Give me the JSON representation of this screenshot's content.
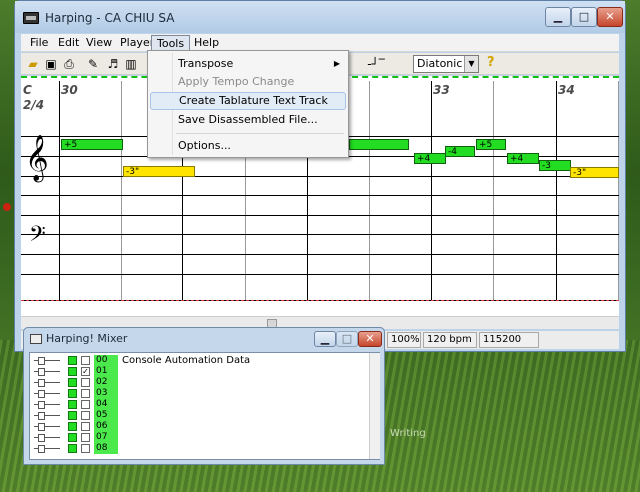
{
  "window": {
    "title": "Harping - CA CHIU SA",
    "caption": {
      "minimize": "▁",
      "maximize": "□",
      "close": "✕"
    }
  },
  "menu": {
    "items": [
      "File",
      "Edit",
      "View",
      "Player",
      "Tools",
      "Help"
    ]
  },
  "tools_menu": {
    "transpose": "Transpose",
    "apply_tempo": "Apply Tempo Change",
    "create_tab": "Create Tablature Text Track",
    "save_disassembled": "Save Disassembled File...",
    "options": "Options..."
  },
  "toolbar": {
    "mode_select": "Diatonic",
    "help_glyph": "?"
  },
  "score": {
    "key": "C",
    "time": "2/4",
    "measures": [
      "30",
      "33",
      "34"
    ],
    "notes": {
      "n1": "+5",
      "n2": "-3\"",
      "n3": "+4",
      "n4": "-4",
      "n5": "+5",
      "n6": "+4",
      "n7": "-3",
      "n8": "-3\""
    }
  },
  "status": {
    "zoom": "100%",
    "tempo": "120 bpm",
    "position": "115200"
  },
  "mixer": {
    "title": "Harping! Mixer",
    "caption": {
      "minimize": "▁",
      "maximize": "□",
      "close": "✕"
    },
    "channels": [
      "00",
      "01",
      "02",
      "03",
      "04",
      "05",
      "06",
      "07",
      "08"
    ],
    "row0_label": "Console Automation Data"
  },
  "desktop": {
    "caption": "Writing"
  }
}
